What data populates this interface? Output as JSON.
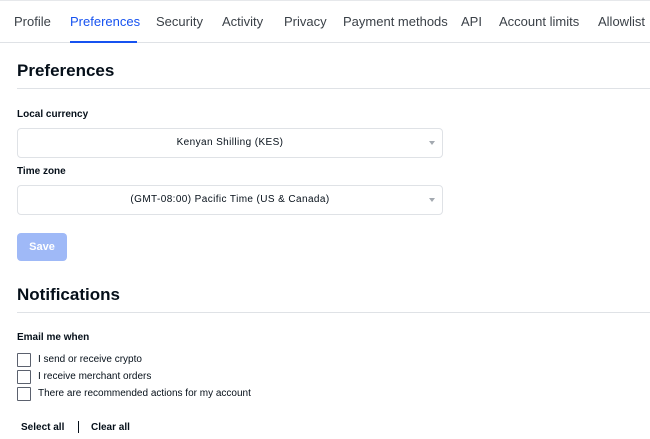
{
  "tabs": [
    {
      "label": "Profile",
      "active": false
    },
    {
      "label": "Preferences",
      "active": true
    },
    {
      "label": "Security",
      "active": false
    },
    {
      "label": "Activity",
      "active": false
    },
    {
      "label": "Privacy",
      "active": false
    },
    {
      "label": "Payment methods",
      "active": false
    },
    {
      "label": "API",
      "active": false
    },
    {
      "label": "Account limits",
      "active": false
    },
    {
      "label": "Allowlist",
      "active": false
    }
  ],
  "preferences": {
    "title": "Preferences",
    "local_currency": {
      "label": "Local currency",
      "value": "Kenyan Shilling (KES)"
    },
    "time_zone": {
      "label": "Time zone",
      "value": "(GMT-08:00) Pacific Time (US & Canada)"
    },
    "save_label": "Save"
  },
  "notifications": {
    "title": "Notifications",
    "email_label": "Email me when",
    "options": [
      {
        "label": "I send or receive crypto",
        "checked": false
      },
      {
        "label": "I receive merchant orders",
        "checked": false
      },
      {
        "label": "There are recommended actions for my account",
        "checked": false
      }
    ],
    "select_all_label": "Select all",
    "clear_all_label": "Clear all"
  },
  "colors": {
    "accent": "#1652f0",
    "disabled_button": "#9fb9f7",
    "divider": "#dfe2e6"
  }
}
